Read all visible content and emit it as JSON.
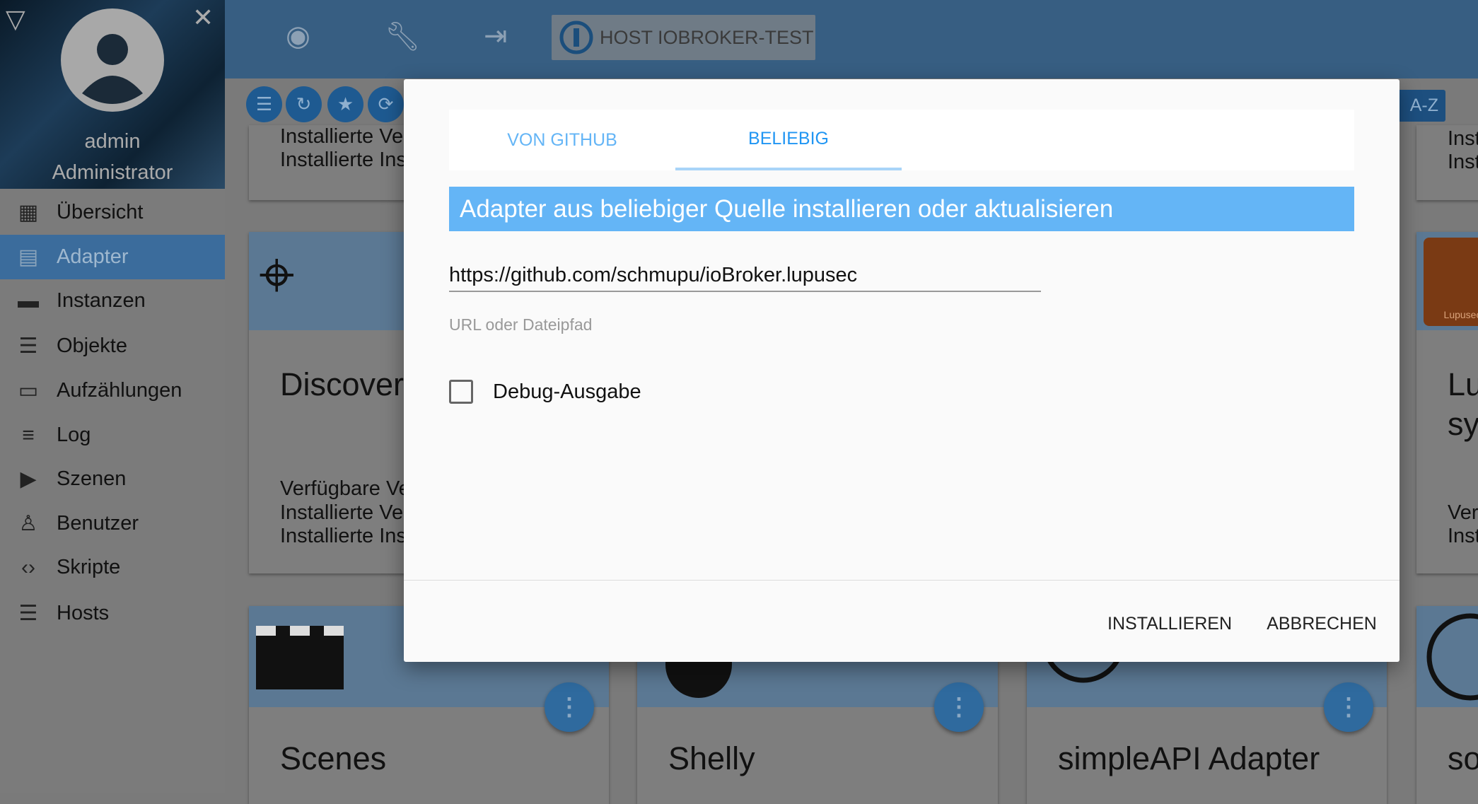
{
  "sidebar": {
    "username": "admin",
    "role": "Administrator",
    "items": [
      {
        "label": "Übersicht",
        "icon": "grid-icon",
        "glyph": "▦"
      },
      {
        "label": "Adapter",
        "icon": "store-icon",
        "glyph": "▤"
      },
      {
        "label": "Instanzen",
        "icon": "instances-icon",
        "glyph": "▬"
      },
      {
        "label": "Objekte",
        "icon": "list-icon",
        "glyph": "☰"
      },
      {
        "label": "Aufzählungen",
        "icon": "enum-icon",
        "glyph": "▭"
      },
      {
        "label": "Log",
        "icon": "log-icon",
        "glyph": "≡"
      },
      {
        "label": "Szenen",
        "icon": "scenes-icon",
        "glyph": "▶"
      },
      {
        "label": "Benutzer",
        "icon": "user-icon",
        "glyph": "♙"
      },
      {
        "label": "Skripte",
        "icon": "code-icon",
        "glyph": "‹›"
      },
      {
        "label": "Hosts",
        "icon": "hosts-icon",
        "glyph": "☰"
      }
    ],
    "active": "Adapter"
  },
  "header": {
    "host_label": "HOST IOBROKER-TEST"
  },
  "toolbar": {
    "sort_label": "A-Z"
  },
  "cards": {
    "top1": [
      "Installierte Ver",
      "Installierte Ins"
    ],
    "top4": [
      "Inst",
      "Inst"
    ],
    "discovery": {
      "title": "Discovery",
      "lines": [
        "Verfügbare Ve",
        "Installierte Ver",
        "Installierte Ins"
      ]
    },
    "lupusec": {
      "title1": "Lu",
      "title2": "sy",
      "lines": [
        "Verf",
        "Inst"
      ],
      "logo_text": "Lupusec"
    },
    "scenes": {
      "title": "Scenes"
    },
    "shelly": {
      "title": "Shelly"
    },
    "simpleapi": {
      "title": "simpleAPI Adapter"
    },
    "so": {
      "title": "so"
    }
  },
  "dialog": {
    "tabs": [
      {
        "label": "VON GITHUB"
      },
      {
        "label": "BELIEBIG"
      }
    ],
    "selected_tab": "BELIEBIG",
    "heading": "Adapter aus beliebiger Quelle installieren oder aktualisieren",
    "url_value": "https://github.com/schmupu/ioBroker.lupusec",
    "url_helper": "URL oder Dateipfad",
    "debug_label": "Debug-Ausgabe",
    "debug_checked": false,
    "install_label": "INSTALLIEREN",
    "cancel_label": "ABBRECHEN"
  },
  "colors": {
    "accent": "#2196f3",
    "heading_bg": "#64b5f6"
  }
}
